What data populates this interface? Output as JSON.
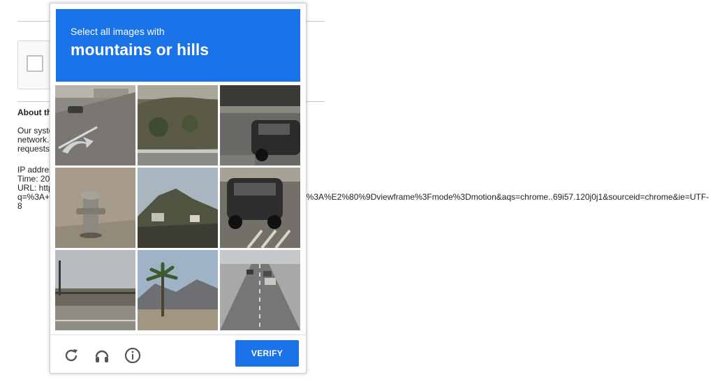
{
  "background_page": {
    "about_heading": "About th",
    "description": "Our syste\nnetwork.\nrequests",
    "meta": "IP addres\nTime: 20\nURL: http\nq=%3A+\n8",
    "url_tail": "rl%3A%E2%80%9Dviewframe%3Fmode%3Dmotion&aqs=chrome..69i57.120j0j1&sourceid=chrome&ie=UTF-"
  },
  "captcha": {
    "instruction": "Select all images with",
    "target": "mountains or hills",
    "tiles": [
      {
        "subject": "road-with-arrow-and-car"
      },
      {
        "subject": "hillside-with-guardrail"
      },
      {
        "subject": "dark-car-on-road"
      },
      {
        "subject": "fire-hydrant"
      },
      {
        "subject": "hill-with-buildings"
      },
      {
        "subject": "car-rear-on-street"
      },
      {
        "subject": "road-with-fence"
      },
      {
        "subject": "palm-tree-with-mountains"
      },
      {
        "subject": "highway-with-cars"
      }
    ],
    "verify_label": "VERIFY",
    "icons": [
      "reload-icon",
      "headphones-icon",
      "info-icon"
    ],
    "accent_color": "#1a73e8"
  }
}
